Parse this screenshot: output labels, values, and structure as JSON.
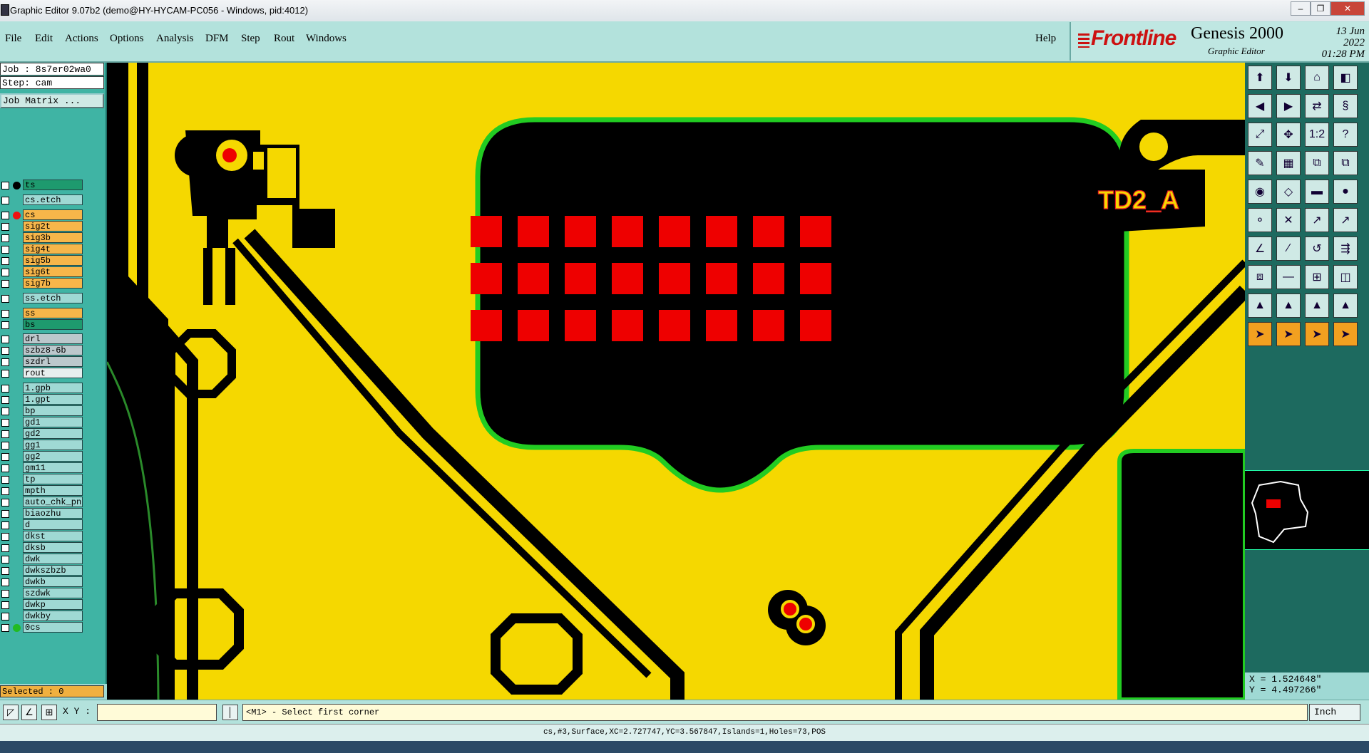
{
  "window": {
    "title": "Graphic Editor 9.07b2 (demo@HY-HYCAM-PC056 - Windows, pid:4012)",
    "controls": [
      "–",
      "❐",
      "✕"
    ]
  },
  "menu": [
    "File",
    "Edit",
    "Actions",
    "Options",
    "Analysis",
    "DFM",
    "Step",
    "Rout",
    "Windows"
  ],
  "help_label": "Help",
  "brand": {
    "logo": "Frontline",
    "product": "Genesis 2000",
    "subtitle": "Graphic Editor",
    "date": "13 Jun 2022",
    "time": "01:28 PM"
  },
  "job": {
    "job_line": "Job : 8s7er02wa0",
    "step_line": "Step: cam",
    "matrix_button": "Job Matrix ..."
  },
  "layers": [
    {
      "name": "ts",
      "color": "#1e9a6e",
      "dot": "#000000"
    },
    {
      "name": "cs.etch",
      "color": "#9fd9d4",
      "dot": ""
    },
    {
      "name": "cs",
      "color": "#f7b64a",
      "dot": "#ee1111"
    },
    {
      "name": "sig2t",
      "color": "#f7b64a",
      "dot": ""
    },
    {
      "name": "sig3b",
      "color": "#f7b64a",
      "dot": ""
    },
    {
      "name": "sig4t",
      "color": "#f7b64a",
      "dot": ""
    },
    {
      "name": "sig5b",
      "color": "#f7b64a",
      "dot": ""
    },
    {
      "name": "sig6t",
      "color": "#f7b64a",
      "dot": ""
    },
    {
      "name": "sig7b",
      "color": "#f7b64a",
      "dot": ""
    },
    {
      "name": "ss.etch",
      "color": "#9fd9d4",
      "dot": ""
    },
    {
      "name": "ss",
      "color": "#f7b64a",
      "dot": ""
    },
    {
      "name": "bs",
      "color": "#1e9a6e",
      "dot": ""
    },
    {
      "name": "drl",
      "color": "#bcc8cc",
      "dot": ""
    },
    {
      "name": "szbz8-6b",
      "color": "#bcc8cc",
      "dot": ""
    },
    {
      "name": "szdrl",
      "color": "#bcc8cc",
      "dot": ""
    },
    {
      "name": "rout",
      "color": "#e6eeee",
      "dot": ""
    },
    {
      "name": "1.gpb",
      "color": "#9fd9d4",
      "dot": ""
    },
    {
      "name": "1.gpt",
      "color": "#9fd9d4",
      "dot": ""
    },
    {
      "name": "bp",
      "color": "#9fd9d4",
      "dot": ""
    },
    {
      "name": "gd1",
      "color": "#9fd9d4",
      "dot": ""
    },
    {
      "name": "gd2",
      "color": "#9fd9d4",
      "dot": ""
    },
    {
      "name": "gg1",
      "color": "#9fd9d4",
      "dot": ""
    },
    {
      "name": "gg2",
      "color": "#9fd9d4",
      "dot": ""
    },
    {
      "name": "gm11",
      "color": "#9fd9d4",
      "dot": ""
    },
    {
      "name": "tp",
      "color": "#9fd9d4",
      "dot": ""
    },
    {
      "name": "mpth",
      "color": "#9fd9d4",
      "dot": ""
    },
    {
      "name": "auto_chk_pn",
      "color": "#9fd9d4",
      "dot": ""
    },
    {
      "name": "biaozhu",
      "color": "#9fd9d4",
      "dot": ""
    },
    {
      "name": "d",
      "color": "#9fd9d4",
      "dot": ""
    },
    {
      "name": "dkst",
      "color": "#9fd9d4",
      "dot": ""
    },
    {
      "name": "dksb",
      "color": "#9fd9d4",
      "dot": ""
    },
    {
      "name": "dwk",
      "color": "#9fd9d4",
      "dot": ""
    },
    {
      "name": "dwkszbzb",
      "color": "#9fd9d4",
      "dot": ""
    },
    {
      "name": "dwkb",
      "color": "#9fd9d4",
      "dot": ""
    },
    {
      "name": "szdwk",
      "color": "#9fd9d4",
      "dot": ""
    },
    {
      "name": "dwkp",
      "color": "#9fd9d4",
      "dot": ""
    },
    {
      "name": "dwkby",
      "color": "#9fd9d4",
      "dot": ""
    },
    {
      "name": "0cs",
      "color": "#9fd9d4",
      "dot": "#22bb22"
    }
  ],
  "selected": "Selected : 0",
  "canvas": {
    "label_text": "TD2_A",
    "board_color": "#f5d800",
    "copper_void_color": "#000000",
    "pad_color": "#ee0000",
    "outline_color": "#22cc22"
  },
  "toolbox": [
    "⬆",
    "⬇",
    "⌂",
    "◧",
    "◀",
    "▶",
    "⇄",
    "§",
    "⤢",
    "✥",
    "1:2",
    "?",
    "✎",
    "▦",
    "⧉",
    "⧉",
    "◉",
    "◇",
    "▬",
    "●",
    "⚬",
    "✕",
    "↗",
    "↗",
    "∠",
    "∕",
    "↺",
    "⇶",
    "⧈",
    "—",
    "⊞",
    "◫",
    "▲",
    "▲",
    "▲",
    "▲",
    "➤",
    "➤",
    "➤",
    "➤"
  ],
  "coords": {
    "x": "X = 1.524648\"",
    "y": "Y = 4.497266\""
  },
  "cmd": {
    "xy_label": "X Y :",
    "xy_value": "",
    "prompt": "<M1> - Select first corner",
    "unit": "Inch"
  },
  "status": "cs,#3,Surface,XC=2.727747,YC=3.567847,Islands=1,Holes=73,POS"
}
